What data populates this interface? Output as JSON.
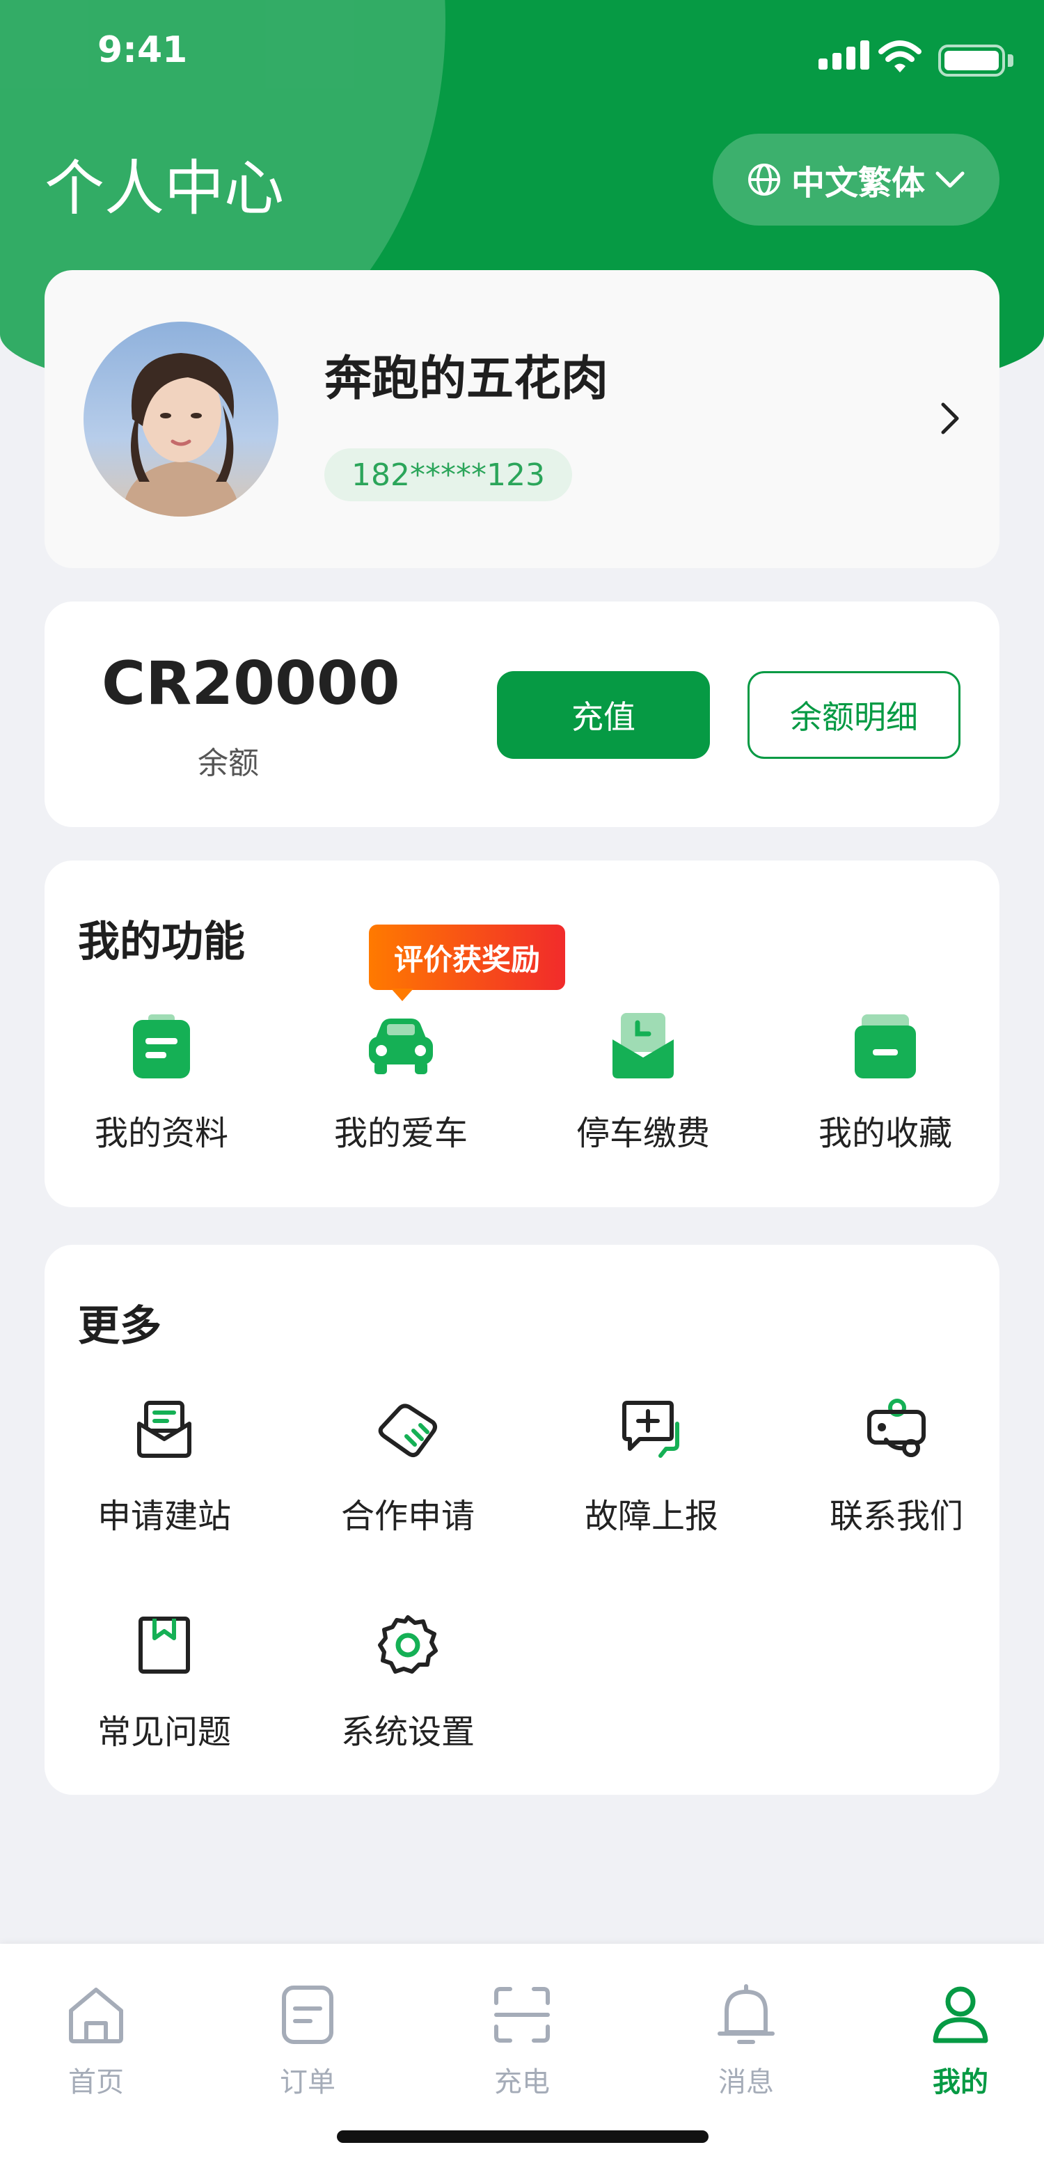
{
  "status_bar": {
    "time": "9:41"
  },
  "header": {
    "title": "个人中心",
    "language_label": "中文繁体"
  },
  "profile": {
    "name": "奔跑的五花肉",
    "phone": "182*****123"
  },
  "balance": {
    "amount": "CR20000",
    "label": "余额",
    "recharge_label": "充值",
    "detail_label": "余额明细"
  },
  "functions": {
    "title": "我的功能",
    "promo_badge": "评价获奖励",
    "items": [
      {
        "label": "我的资料",
        "icon": "profile-doc-icon"
      },
      {
        "label": "我的爱车",
        "icon": "car-icon"
      },
      {
        "label": "停车缴费",
        "icon": "parking-payment-icon"
      },
      {
        "label": "我的收藏",
        "icon": "favorites-box-icon"
      }
    ]
  },
  "more": {
    "title": "更多",
    "items": [
      {
        "label": "申请建站",
        "icon": "apply-station-icon"
      },
      {
        "label": "合作申请",
        "icon": "cooperation-icon"
      },
      {
        "label": "故障上报",
        "icon": "report-fault-icon"
      },
      {
        "label": "联系我们",
        "icon": "contact-us-icon"
      },
      {
        "label": "常见问题",
        "icon": "faq-bookmark-icon"
      },
      {
        "label": "系统设置",
        "icon": "settings-gear-icon"
      }
    ]
  },
  "tabbar": {
    "items": [
      {
        "label": "首页",
        "icon": "home-icon"
      },
      {
        "label": "订单",
        "icon": "order-icon"
      },
      {
        "label": "充电",
        "icon": "scan-charge-icon"
      },
      {
        "label": "消息",
        "icon": "bell-icon"
      },
      {
        "label": "我的",
        "icon": "user-icon",
        "active": true
      }
    ]
  },
  "colors": {
    "brand_green": "#069a44",
    "light_green": "#2bb35f",
    "inactive_gray": "#a5acb8",
    "background": "#f0f1f5"
  }
}
